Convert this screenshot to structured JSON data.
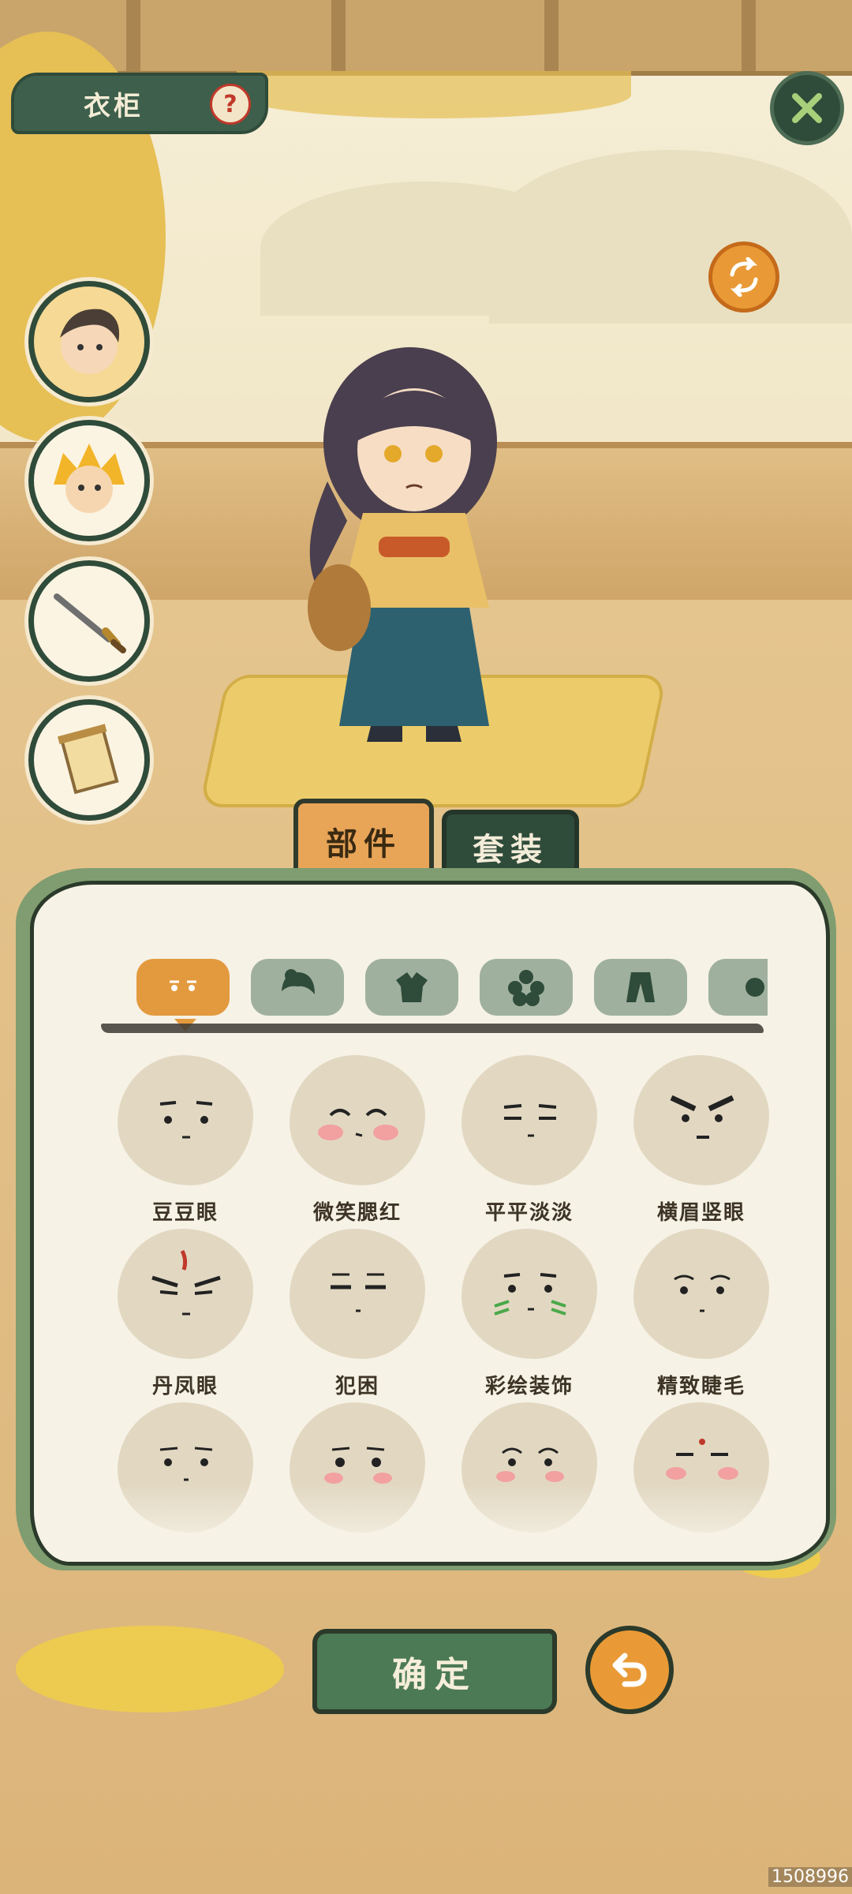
{
  "header": {
    "title": "衣柜",
    "help_icon": "?"
  },
  "tabs": [
    {
      "label": "部件",
      "active": true
    },
    {
      "label": "套装",
      "active": false
    }
  ],
  "categories": [
    {
      "icon": "face-icon",
      "active": true
    },
    {
      "icon": "hair-icon",
      "active": false
    },
    {
      "icon": "clothes-icon",
      "active": false
    },
    {
      "icon": "flower-accessory-icon",
      "active": false
    },
    {
      "icon": "pants-icon",
      "active": false
    },
    {
      "icon": "more-category-icon",
      "active": false
    }
  ],
  "side_buttons": [
    {
      "icon": "boy-avatar-icon",
      "active": true
    },
    {
      "icon": "monkey-king-avatar-icon",
      "active": false
    },
    {
      "icon": "sword-icon",
      "active": false
    },
    {
      "icon": "scroll-icon",
      "active": false
    }
  ],
  "items": [
    {
      "label": "豆豆眼"
    },
    {
      "label": "微笑腮红"
    },
    {
      "label": "平平淡淡"
    },
    {
      "label": "横眉竖眼"
    },
    {
      "label": "丹凤眼"
    },
    {
      "label": "犯困"
    },
    {
      "label": "彩绘装饰"
    },
    {
      "label": "精致睫毛"
    },
    {
      "label": ""
    },
    {
      "label": ""
    },
    {
      "label": ""
    },
    {
      "label": ""
    }
  ],
  "actions": {
    "confirm_label": "确定"
  },
  "watermark": "1508996",
  "colors": {
    "primary_green": "#2f4b3a",
    "accent_orange": "#e39a3e",
    "panel_bg": "#f6f2e6"
  }
}
